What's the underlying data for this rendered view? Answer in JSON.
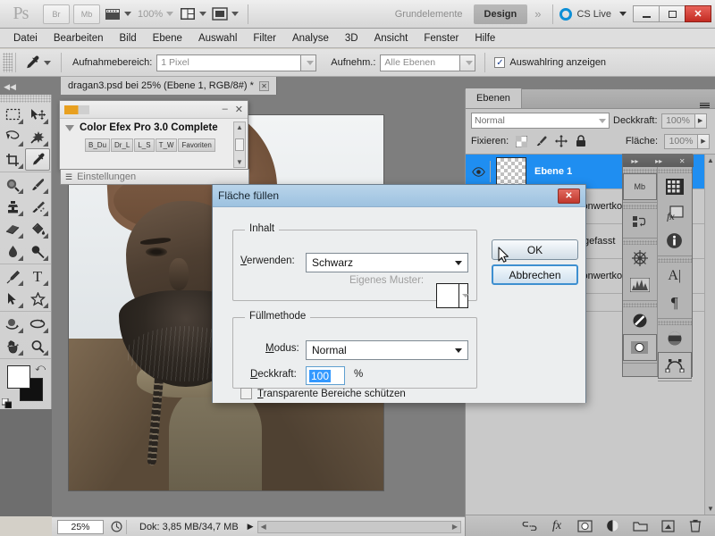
{
  "appbar": {
    "logo": "Ps",
    "bridge": "Br",
    "mini_bridge": "Mb",
    "view_extras": "view-extras-icon",
    "zoom_level": "100%",
    "arrange": "arrange-documents-icon",
    "screen_mode": "screen-mode-icon",
    "workspaces": [
      {
        "label": "Grundelemente",
        "active": false
      },
      {
        "label": "Design",
        "active": true
      }
    ],
    "more_workspaces": "»",
    "cs_live": "CS Live",
    "window_buttons": [
      "minimize",
      "maximize",
      "close"
    ]
  },
  "menubar": {
    "items": [
      "Datei",
      "Bearbeiten",
      "Bild",
      "Ebene",
      "Auswahl",
      "Filter",
      "Analyse",
      "3D",
      "Ansicht",
      "Fenster",
      "Hilfe"
    ]
  },
  "optionsbar": {
    "tool_icon": "eyedropper-icon",
    "sample_size_label": "Aufnahmebereich:",
    "sample_size_value": "1 Pixel",
    "sample_from_label": "Aufnehm.:",
    "sample_from_value": "Alle Ebenen",
    "show_ring_label": "Auswahlring anzeigen",
    "show_ring_checked": true,
    "check_glyph": "✓"
  },
  "document_tab": {
    "title": "dragan3.psd bei 25% (Ebene 1, RGB/8#) *",
    "close_glyph": "✕"
  },
  "toolbox": {
    "tools": [
      [
        "marquee-icon",
        "move-icon"
      ],
      [
        "lasso-icon",
        "magic-wand-icon"
      ],
      [
        "crop-icon",
        "eyedropper-icon"
      ],
      [
        "spot-healing-icon",
        "brush-icon"
      ],
      [
        "clone-stamp-icon",
        "history-brush-icon"
      ],
      [
        "eraser-icon",
        "paint-bucket-icon"
      ],
      [
        "blur-icon",
        "dodge-icon"
      ],
      [
        "pen-icon",
        "type-icon"
      ],
      [
        "path-selection-icon",
        "custom-shape-icon"
      ],
      [
        "3d-rotate-icon",
        "3d-orbit-icon"
      ],
      [
        "hand-icon",
        "zoom-icon"
      ]
    ],
    "selected_tool": "eyedropper-icon",
    "foreground_color": "#ffffff",
    "background_color": "#111111",
    "quickmask": "quick-mask-icon"
  },
  "colorefex": {
    "title_logo": "nik-software-logo",
    "heading": "Color Efex Pro 3.0 Complete",
    "tabs": [
      "B_Du",
      "Dr_L",
      "L_S",
      "T_W",
      "Favoriten"
    ],
    "status": "Einstellungen",
    "minimize_glyph": "–",
    "close_glyph": "✕"
  },
  "statusbar": {
    "zoom": "25%",
    "preview_icon": "doc-preview-icon",
    "doc_info": "Dok: 3,85 MB/34,7 MB",
    "expand_glyph": "▶"
  },
  "layers_panel": {
    "tab_label": "Ebenen",
    "menu_icon": "panel-menu-icon",
    "blend_mode": "Normal",
    "opacity_label": "Deckkraft:",
    "opacity_value": "100%",
    "lock_label": "Fixieren:",
    "lock_icons": [
      "lock-transparency-icon",
      "lock-image-icon",
      "lock-position-icon",
      "lock-all-icon"
    ],
    "fill_label": "Fläche:",
    "fill_value": "100%",
    "layers": [
      {
        "name": "Ebene 1",
        "thumb": "transparent-checker",
        "selected": true,
        "has_mask": false
      },
      {
        "name": "Tonwertkorrektur 2",
        "thumb": "levels-adjustment",
        "selected": false,
        "has_mask": true
      },
      {
        "name": "Zusammengefasst",
        "thumb": "merged-photo",
        "selected": false,
        "has_mask": false
      },
      {
        "name": "Tonwertkorrektur 1",
        "thumb": "levels-adjustment",
        "selected": false,
        "has_mask": true
      },
      {
        "name": "",
        "thumb": "orange-layer",
        "selected": false,
        "has_mask": false
      }
    ],
    "footer_icons": [
      "link-layers-icon",
      "layer-style-fx-icon",
      "add-mask-icon",
      "adjustment-layer-icon",
      "new-group-icon",
      "new-layer-icon",
      "delete-layer-icon"
    ]
  },
  "minidock": {
    "columns": [
      [
        "mini-bridge-icon",
        "actions-icon",
        "3d-icon",
        "histogram-icon",
        "swatches-icon",
        "mask-icon"
      ],
      [
        "color-grid-icon",
        "layer-fx-icon",
        "info-icon",
        "character-icon",
        "paragraph-icon",
        "3d-material-icon",
        "path-icon"
      ]
    ],
    "collapse_glyph": "▸▸",
    "close_glyph": "✕"
  },
  "fill_dialog": {
    "title": "Fläche füllen",
    "close_glyph": "✕",
    "content_group": "Inhalt",
    "use_label": "Verwenden:",
    "use_value": "Schwarz",
    "custom_pattern_label": "Eigenes Muster:",
    "custom_pattern_enabled": false,
    "blend_group": "Füllmethode",
    "mode_label": "Modus:",
    "mode_value": "Normal",
    "opacity_label": "Deckkraft:",
    "opacity_value": "100",
    "percent_sign": "%",
    "preserve_label": "Transparente Bereiche schützen",
    "preserve_checked": false,
    "ok_label": "OK",
    "cancel_label": "Abbrechen",
    "focused_button": "Abbrechen"
  }
}
